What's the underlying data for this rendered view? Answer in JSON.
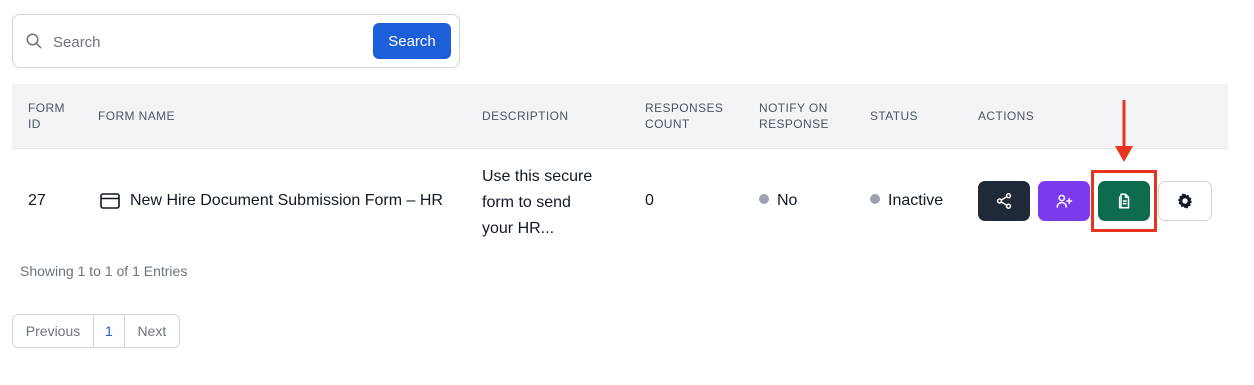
{
  "search": {
    "placeholder": "Search",
    "button_label": "Search"
  },
  "table": {
    "headers": {
      "form_id": [
        "FORM",
        "ID"
      ],
      "form_name": "FORM NAME",
      "description": "DESCRIPTION",
      "responses_count": [
        "RESPONSES",
        "COUNT"
      ],
      "notify": [
        "NOTIFY ON",
        "RESPONSE"
      ],
      "status": "STATUS",
      "actions": "ACTIONS"
    },
    "rows": [
      {
        "form_id": "27",
        "form_name": "New Hire Document Submission Form – HR",
        "form_icon": "browser-window-icon",
        "description": [
          "Use this secure",
          "form to send",
          "your HR..."
        ],
        "responses_count": "0",
        "notify": "No",
        "status": "Inactive",
        "actions": [
          {
            "name": "share",
            "icon": "share-icon",
            "color": "#1f2937"
          },
          {
            "name": "add-user",
            "icon": "user-plus-icon",
            "color": "#7c3aed"
          },
          {
            "name": "responses",
            "icon": "document-icon",
            "color": "#0f6b4f"
          },
          {
            "name": "settings",
            "icon": "gear-icon",
            "color": "#ffffff"
          }
        ]
      }
    ]
  },
  "summary": "Showing 1 to 1 of 1 Entries",
  "pagination": {
    "previous": "Previous",
    "current_page": "1",
    "next": "Next"
  },
  "colors": {
    "accent": "#1d5fd8",
    "annotation": "#e8331f",
    "status_dot": "#9ca3af"
  }
}
